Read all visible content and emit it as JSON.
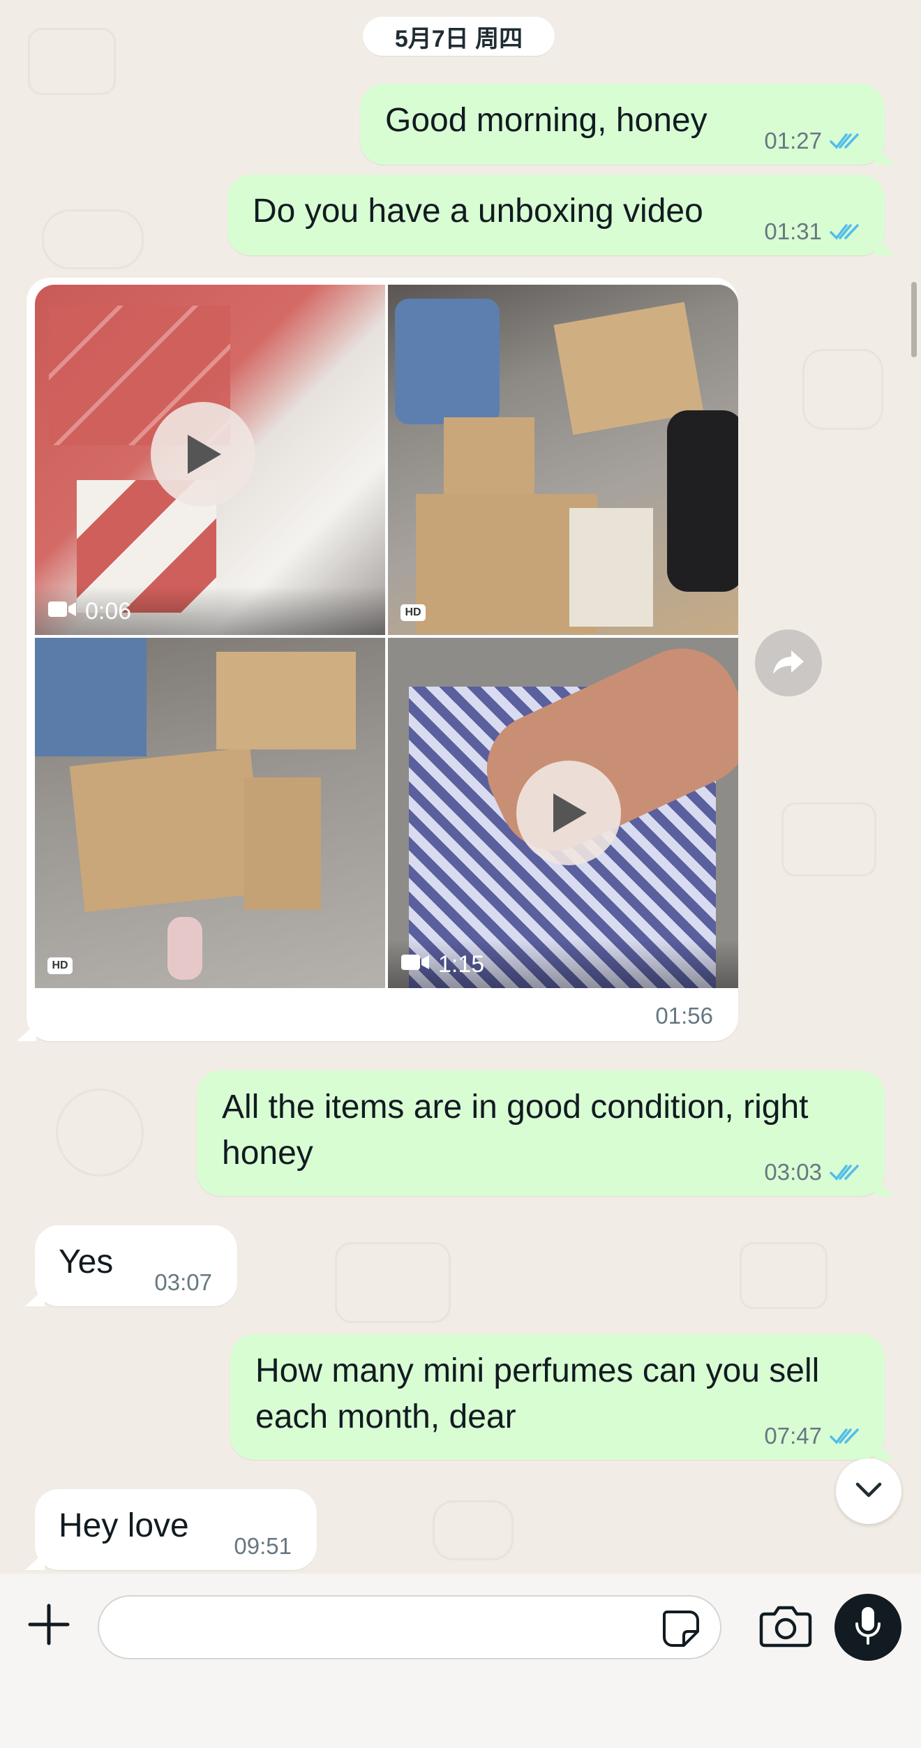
{
  "date_chip": "5月7日 周四",
  "messages": {
    "m1": {
      "text": "Good morning, honey",
      "time": "01:27",
      "status": "read"
    },
    "m2": {
      "text": "Do you have a unboxing video",
      "time": "01:31",
      "status": "read"
    },
    "media": {
      "time": "01:56",
      "tiles": [
        {
          "type": "video",
          "duration": "0:06"
        },
        {
          "type": "image",
          "badge": "HD"
        },
        {
          "type": "image",
          "badge": "HD"
        },
        {
          "type": "video",
          "duration": "1:15"
        }
      ]
    },
    "m3": {
      "text": "All the items are in good condition, right\nhoney",
      "time": "03:03",
      "status": "read"
    },
    "m4": {
      "text": "Yes",
      "time": "03:07"
    },
    "m5": {
      "text": "How many mini perfumes can you sell\neach month, dear",
      "time": "07:47",
      "status": "read"
    },
    "m6": {
      "text": "Hey love",
      "time": "09:51"
    }
  },
  "input": {
    "placeholder": ""
  },
  "icons": {
    "read_tick_color": "#53bdeb",
    "outgoing_bubble": "#d9fdd3",
    "incoming_bubble": "#ffffff",
    "mic_button": "#111b21"
  }
}
